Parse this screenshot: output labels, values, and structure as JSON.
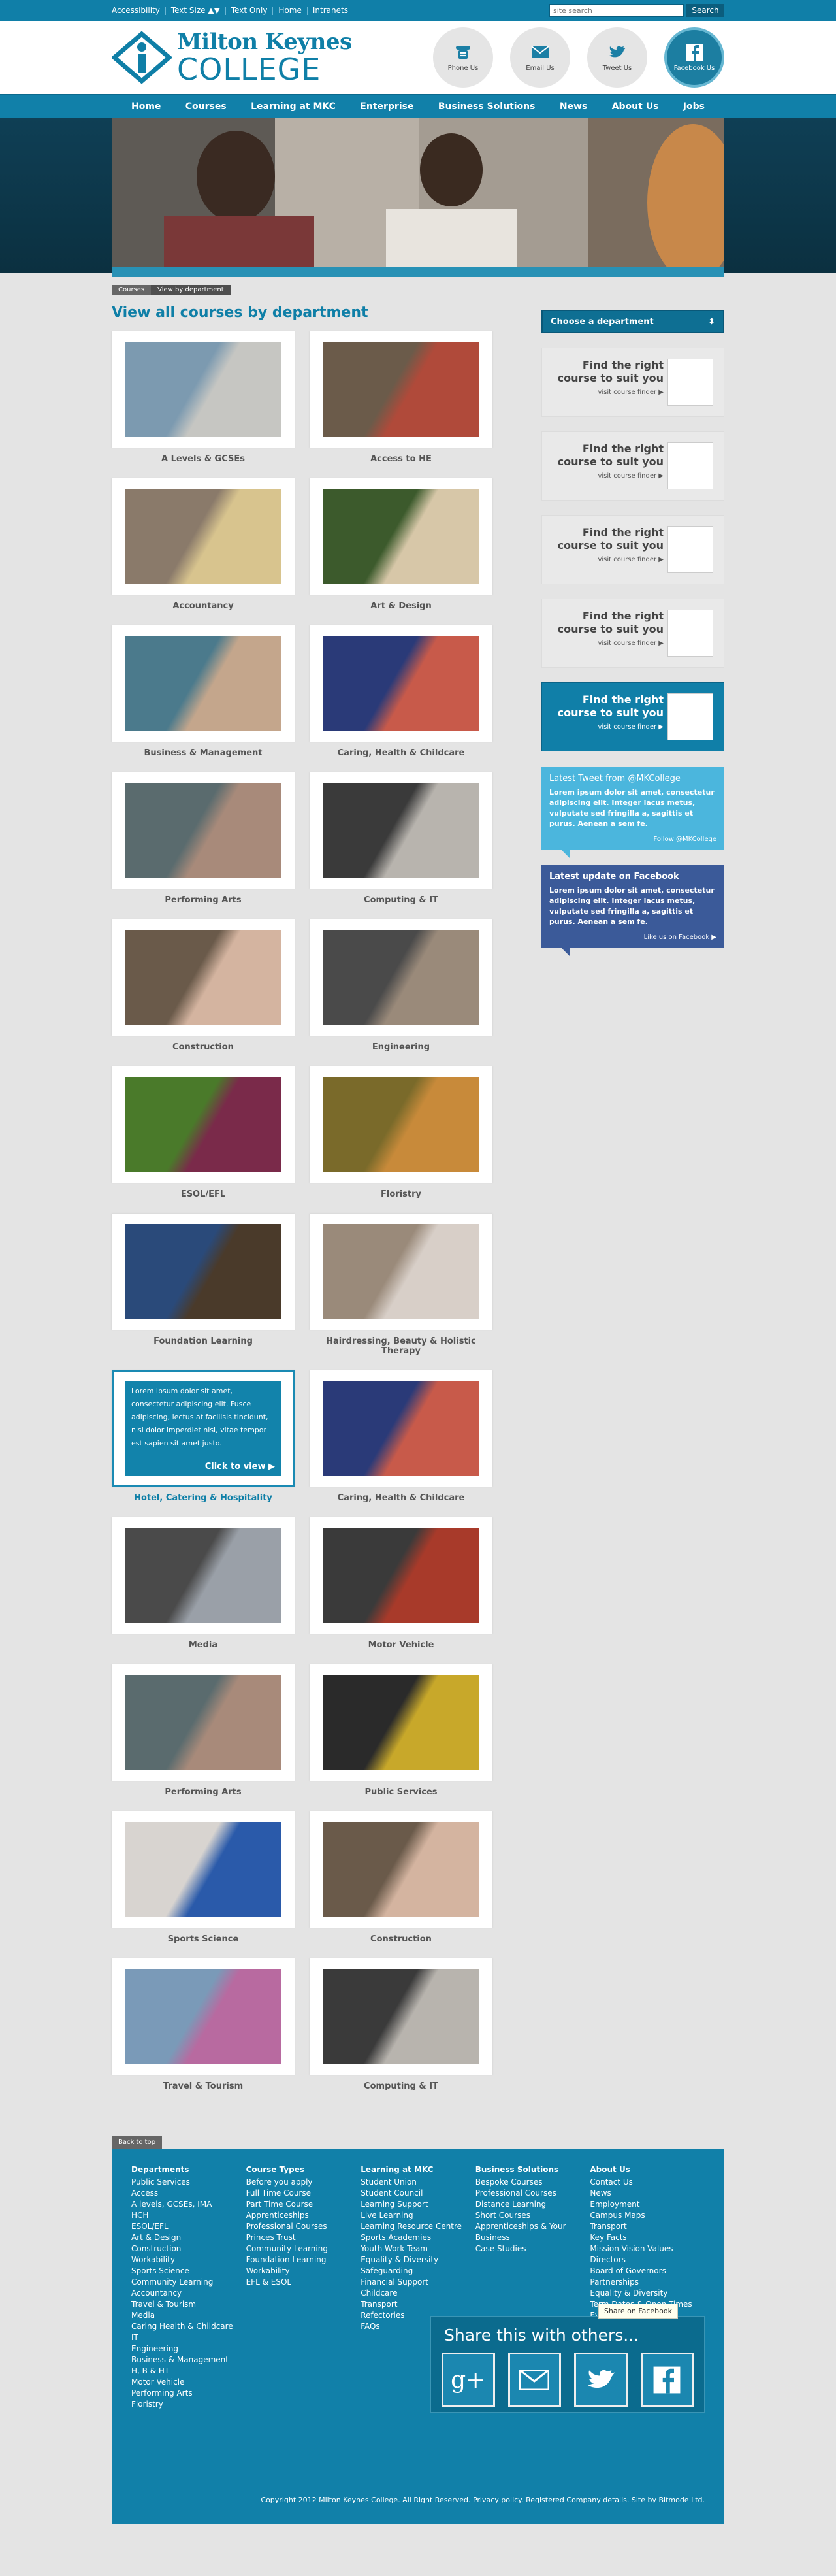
{
  "topbar": {
    "links": [
      "Accessibility",
      "Text Size ▲▼",
      "Text Only",
      "Home",
      "Intranets"
    ],
    "search_placeholder": "site search",
    "search_button": "Search"
  },
  "logo": {
    "line1": "Milton Keynes",
    "line2": "COLLEGE"
  },
  "contacts": [
    {
      "label": "Phone Us",
      "icon": "phone-icon"
    },
    {
      "label": "Email Us",
      "icon": "email-icon"
    },
    {
      "label": "Tweet Us",
      "icon": "twitter-icon"
    },
    {
      "label": "Facebook Us",
      "icon": "facebook-icon"
    }
  ],
  "nav": [
    "Home",
    "Courses",
    "Learning at MKC",
    "Enterprise",
    "Business Solutions",
    "News",
    "About Us",
    "Jobs"
  ],
  "breadcrumb": [
    "Courses",
    "View by department"
  ],
  "page_title": "View all courses by department",
  "courses": [
    {
      "label": "A Levels & GCSEs",
      "c1": "#7c9ab0",
      "c2": "#c6c6c2"
    },
    {
      "label": "Access to HE",
      "c1": "#6b5b4a",
      "c2": "#b04a3a"
    },
    {
      "label": "Accountancy",
      "c1": "#8a7a6a",
      "c2": "#d8c48e"
    },
    {
      "label": "Art & Design",
      "c1": "#3c5a2c",
      "c2": "#d7c7a8"
    },
    {
      "label": "Business & Management",
      "c1": "#4b7a8c",
      "c2": "#c4a68c"
    },
    {
      "label": "Caring, Health & Childcare",
      "c1": "#2a3a78",
      "c2": "#c85a4a"
    },
    {
      "label": "Performing Arts",
      "c1": "#5a6b6e",
      "c2": "#a88a7a"
    },
    {
      "label": "Computing & IT",
      "c1": "#3a3a3a",
      "c2": "#b8b4ae"
    },
    {
      "label": "Construction",
      "c1": "#6a5a4a",
      "c2": "#d4b4a0"
    },
    {
      "label": "Engineering",
      "c1": "#4a4a4a",
      "c2": "#9a8a7a"
    },
    {
      "label": "ESOL/EFL",
      "c1": "#4a7a2a",
      "c2": "#7a2a4a"
    },
    {
      "label": "Floristry",
      "c1": "#7a6a2a",
      "c2": "#c88a3a"
    },
    {
      "label": "Foundation Learning",
      "c1": "#2a4a7a",
      "c2": "#4a3a2a"
    },
    {
      "label": "Hairdressing, Beauty & Holistic Therapy",
      "c1": "#9a8a7a",
      "c2": "#d8cfc8"
    }
  ],
  "highlight": {
    "label": "Hotel, Catering & Hospitality",
    "text": "Lorem ipsum dolor sit amet, consectetur adipiscing elit. Fusce adipiscing, lectus at facilisis tincidunt, nisl dolor imperdiet nisl, vitae tempor est sapien sit amet justo.",
    "cta": "Click to view ▶"
  },
  "courses2": [
    {
      "label": "Caring, Health & Childcare",
      "c1": "#2a3a78",
      "c2": "#c85a4a"
    },
    {
      "label": "Media",
      "c1": "#4a4a4a",
      "c2": "#9aa0a8"
    },
    {
      "label": "Motor Vehicle",
      "c1": "#3a3a3a",
      "c2": "#a83a2a"
    },
    {
      "label": "Performing Arts",
      "c1": "#5a6b6e",
      "c2": "#a88a7a"
    },
    {
      "label": "Public Services",
      "c1": "#2a2a2a",
      "c2": "#c8a82a"
    },
    {
      "label": "Sports Science",
      "c1": "#d8d4d0",
      "c2": "#2a5aaa"
    },
    {
      "label": "Construction",
      "c1": "#6a5a4a",
      "c2": "#d4b4a0"
    },
    {
      "label": "Travel & Tourism",
      "c1": "#7a9ab8",
      "c2": "#b86aa0"
    },
    {
      "label": "Computing & IT",
      "c1": "#3a3a3a",
      "c2": "#b8b4ae"
    }
  ],
  "sidebar": {
    "dept_label": "Choose a department",
    "finder_title": "Find the right course to suit you",
    "finder_link": "visit course finder ▶",
    "twitter_title": "Latest Tweet from @MKCollege",
    "twitter_text": "Lorem ipsum dolor sit amet, consectetur adipiscing elit. Integer lacus metus, vulputate sed fringilla a, sagittis et purus. Aenean a sem fe.",
    "twitter_follow": "Follow @MKCollege",
    "fb_title": "Latest update on Facebook",
    "fb_text": "Lorem ipsum dolor sit amet, consectetur adipiscing elit. Integer lacus metus, vulputate sed fringilla a, sagittis et purus. Aenean a sem fe.",
    "fb_like": "Like us on Facebook ▶"
  },
  "footer": {
    "back_to_top": "Back to top",
    "columns": [
      {
        "title": "Departments",
        "links": [
          "Public Services",
          "Access",
          "A levels, GCSEs, IMA",
          "HCH",
          "ESOL/EFL",
          "Art & Design",
          "Construction",
          "Workability",
          "Sports Science",
          "Community Learning",
          "Accountancy",
          "Travel & Tourism",
          "Media",
          "Caring Health & Childcare",
          "IT",
          "Engineering",
          "Business & Management",
          "H, B & HT",
          "Motor Vehicle",
          "Performing Arts",
          "Floristry"
        ]
      },
      {
        "title": "Course Types",
        "links": [
          "Before you apply",
          "Full Time Course",
          "Part Time Course",
          "Apprenticeships",
          "Professional Courses",
          "Princes Trust",
          "Community Learning",
          "Foundation Learning",
          "Workability",
          "EFL & ESOL"
        ]
      },
      {
        "title": "Learning at MKC",
        "links": [
          "Student Union",
          "Student Council",
          "Learning Support",
          "Live Learning",
          "Learning Resource Centre",
          "Sports Academies",
          "Youth Work Team",
          "Equality & Diversity",
          "Safeguarding",
          "Financial Support",
          "Childcare",
          "Transport",
          "Refectories",
          "FAQs"
        ]
      },
      {
        "title": "Business Solutions",
        "links": [
          "Bespoke Courses",
          "Professional Courses",
          "Distance Learning",
          "Short Courses",
          "Apprenticeships & Your Business",
          "Case Studies"
        ]
      },
      {
        "title": "About Us",
        "links": [
          "Contact Us",
          "News",
          "Employment",
          "Campus Maps",
          "Transport",
          "Key Facts",
          "Mission Vision Values",
          "Directors",
          "Board of Governors",
          "Partnerships",
          "Equality & Diversity",
          "Term Dates & Open Times",
          "Events",
          "Policies"
        ]
      }
    ],
    "share_title": "Share this with others...",
    "share_tag": "Share on Facebook",
    "copyright": "Copyright 2012 Milton Keynes College. All Right Reserved. Privacy policy. Registered Company details. Site by Bitmode Ltd."
  }
}
